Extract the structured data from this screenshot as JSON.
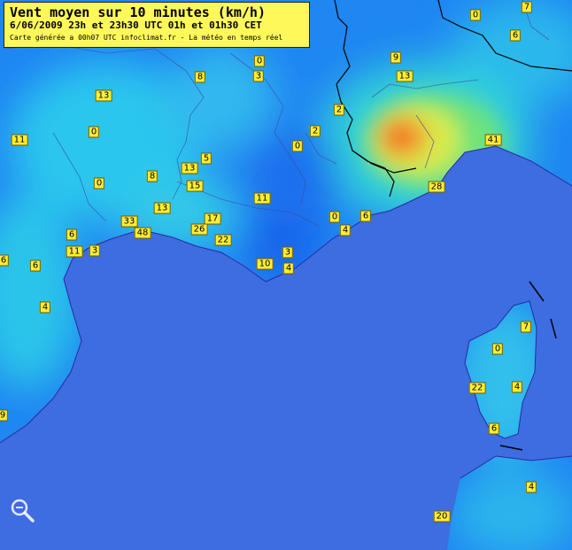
{
  "header": {
    "title": "Vent moyen sur 10 minutes (km/h)",
    "subtitle": "6/06/2009   23h et 23h30 UTC   01h et 01h30 CET",
    "credit": "Carte générée a 00h07 UTC   infoclimat.fr - La météo en temps réel"
  },
  "icons": {
    "zoom": "magnifier-zoom-icon"
  },
  "colors": {
    "sea": "#3d6de0",
    "calm": "#2a7bf0",
    "light": "#25c4e8",
    "moderate": "#7fe86a",
    "strong": "#f0e23a",
    "max": "#f07a28"
  },
  "stations": [
    {
      "v": "0"
    },
    {
      "v": "7"
    },
    {
      "v": "6"
    },
    {
      "v": "9"
    },
    {
      "v": "13"
    },
    {
      "v": "0"
    },
    {
      "v": "3"
    },
    {
      "v": "8"
    },
    {
      "v": "13"
    },
    {
      "v": "2"
    },
    {
      "v": "2"
    },
    {
      "v": "11"
    },
    {
      "v": "0"
    },
    {
      "v": "0"
    },
    {
      "v": "5"
    },
    {
      "v": "13"
    },
    {
      "v": "41"
    },
    {
      "v": "8"
    },
    {
      "v": "0"
    },
    {
      "v": "15"
    },
    {
      "v": "28"
    },
    {
      "v": "11"
    },
    {
      "v": "13"
    },
    {
      "v": "33"
    },
    {
      "v": "17"
    },
    {
      "v": "0"
    },
    {
      "v": "6"
    },
    {
      "v": "48"
    },
    {
      "v": "26"
    },
    {
      "v": "4"
    },
    {
      "v": "6"
    },
    {
      "v": "22"
    },
    {
      "v": "11"
    },
    {
      "v": "3"
    },
    {
      "v": "3"
    },
    {
      "v": "6"
    },
    {
      "v": "6"
    },
    {
      "v": "10"
    },
    {
      "v": "4"
    },
    {
      "v": "4"
    },
    {
      "v": "7"
    },
    {
      "v": "0"
    },
    {
      "v": "22"
    },
    {
      "v": "4"
    },
    {
      "v": "6"
    },
    {
      "v": "9"
    },
    {
      "v": "4"
    },
    {
      "v": "20"
    }
  ]
}
